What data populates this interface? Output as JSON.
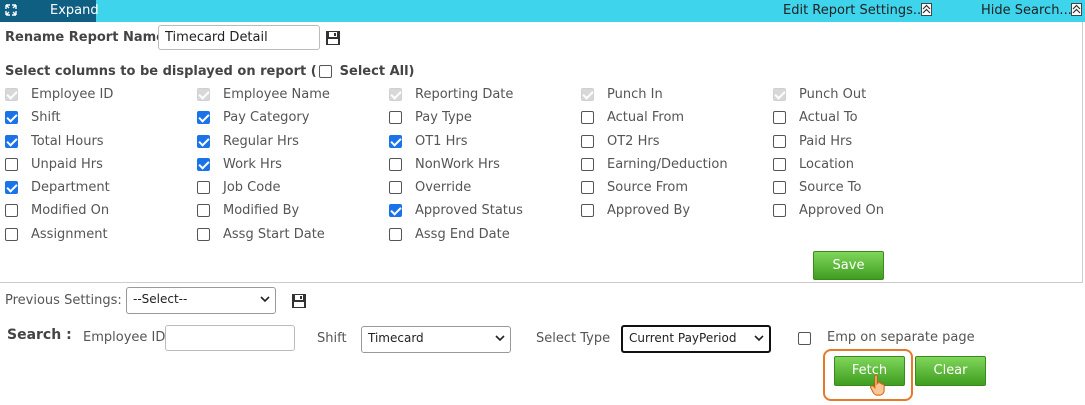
{
  "header": {
    "expand_label": "Expand",
    "edit_settings_label": "Edit Report Settings...",
    "hide_search_label": "Hide Search..."
  },
  "rename": {
    "label": "Rename Report Name:",
    "value": "Timecard Detail"
  },
  "columns_section": {
    "title_prefix": "Select columns to be displayed on report (",
    "select_all_label": "Select All)"
  },
  "columns": [
    [
      {
        "label": "Employee ID",
        "state": "disabled"
      },
      {
        "label": "Shift",
        "state": "checked"
      },
      {
        "label": "Total Hours",
        "state": "checked"
      },
      {
        "label": "Unpaid Hrs",
        "state": "unchecked"
      },
      {
        "label": "Department",
        "state": "checked"
      },
      {
        "label": "Modified On",
        "state": "unchecked"
      },
      {
        "label": "Assignment",
        "state": "unchecked"
      }
    ],
    [
      {
        "label": "Employee Name",
        "state": "disabled"
      },
      {
        "label": "Pay Category",
        "state": "checked"
      },
      {
        "label": "Regular Hrs",
        "state": "checked"
      },
      {
        "label": "Work Hrs",
        "state": "checked"
      },
      {
        "label": "Job Code",
        "state": "unchecked"
      },
      {
        "label": "Modified By",
        "state": "unchecked"
      },
      {
        "label": "Assg Start Date",
        "state": "unchecked"
      }
    ],
    [
      {
        "label": "Reporting Date",
        "state": "disabled"
      },
      {
        "label": "Pay Type",
        "state": "unchecked"
      },
      {
        "label": "OT1 Hrs",
        "state": "checked"
      },
      {
        "label": "NonWork Hrs",
        "state": "unchecked"
      },
      {
        "label": "Override",
        "state": "unchecked"
      },
      {
        "label": "Approved Status",
        "state": "checked"
      },
      {
        "label": "Assg End Date",
        "state": "unchecked"
      }
    ],
    [
      {
        "label": "Punch In",
        "state": "disabled"
      },
      {
        "label": "Actual From",
        "state": "unchecked"
      },
      {
        "label": "OT2 Hrs",
        "state": "unchecked"
      },
      {
        "label": "Earning/Deduction",
        "state": "unchecked"
      },
      {
        "label": "Source From",
        "state": "unchecked"
      },
      {
        "label": "Approved By",
        "state": "unchecked"
      }
    ],
    [
      {
        "label": "Punch Out",
        "state": "disabled"
      },
      {
        "label": "Actual To",
        "state": "unchecked"
      },
      {
        "label": "Paid Hrs",
        "state": "unchecked"
      },
      {
        "label": "Location",
        "state": "unchecked"
      },
      {
        "label": "Source To",
        "state": "unchecked"
      },
      {
        "label": "Approved On",
        "state": "unchecked"
      }
    ]
  ],
  "save_button_label": "Save",
  "previous_settings": {
    "label": "Previous Settings:",
    "selected": "--Select--"
  },
  "search": {
    "label": "Search :",
    "employee_id_label": "Employee ID",
    "employee_id_value": "",
    "shift_label": "Shift",
    "shift_selected": "Timecard",
    "select_type_label": "Select Type",
    "select_type_selected": "Current PayPeriod",
    "emp_separate_label": "Emp on separate page",
    "fetch_label": "Fetch",
    "clear_label": "Clear"
  },
  "colors": {
    "topbar": "#3dd4ec",
    "expand_tab": "#0e5f82",
    "button_green": "#4caf2a",
    "highlight": "#e8782a",
    "checkbox_blue": "#1a73e8"
  }
}
